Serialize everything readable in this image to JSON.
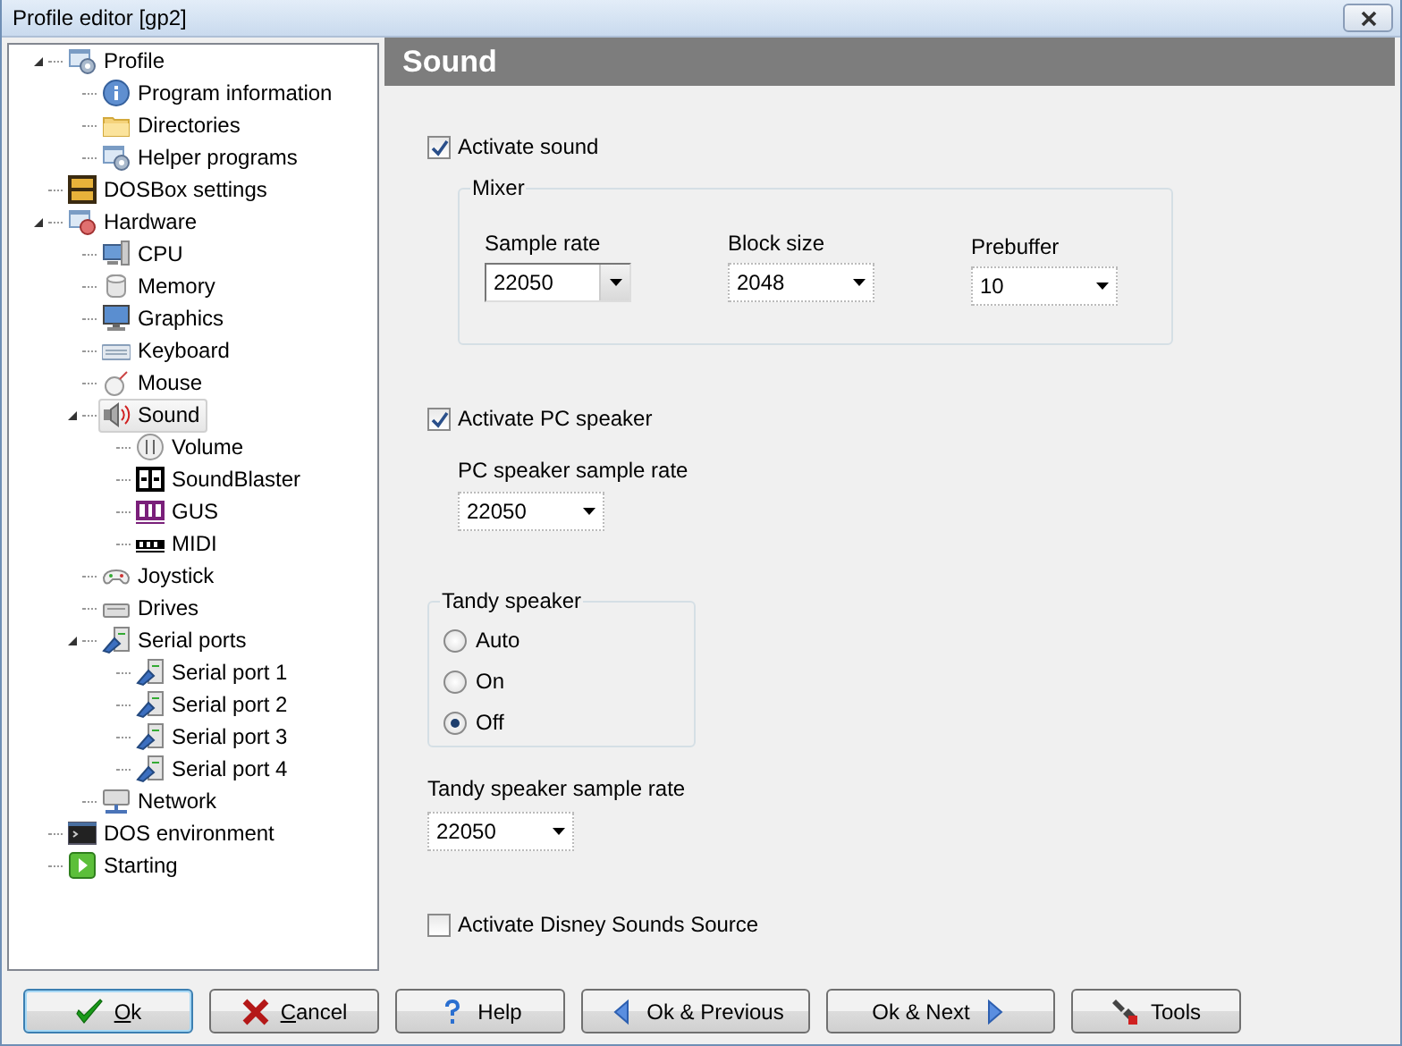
{
  "window": {
    "title": "Profile editor [gp2]"
  },
  "tree": {
    "items": [
      {
        "label": "Profile",
        "kind": "profile",
        "selected": false,
        "expanded": true,
        "children": [
          {
            "label": "Program information",
            "kind": "info",
            "selected": false
          },
          {
            "label": "Directories",
            "kind": "folder",
            "selected": false
          },
          {
            "label": "Helper programs",
            "kind": "profile",
            "selected": false
          }
        ]
      },
      {
        "label": "DOSBox settings",
        "kind": "dosbox",
        "selected": false
      },
      {
        "label": "Hardware",
        "kind": "hardware",
        "selected": false,
        "expanded": true,
        "children": [
          {
            "label": "CPU",
            "kind": "cpu",
            "selected": false
          },
          {
            "label": "Memory",
            "kind": "memory",
            "selected": false
          },
          {
            "label": "Graphics",
            "kind": "monitor",
            "selected": false
          },
          {
            "label": "Keyboard",
            "kind": "keyboard",
            "selected": false
          },
          {
            "label": "Mouse",
            "kind": "mouse",
            "selected": false
          },
          {
            "label": "Sound",
            "kind": "sound",
            "selected": true,
            "expanded": true,
            "children": [
              {
                "label": "Volume",
                "kind": "volume",
                "selected": false
              },
              {
                "label": "SoundBlaster",
                "kind": "sb",
                "selected": false
              },
              {
                "label": "GUS",
                "kind": "gus",
                "selected": false
              },
              {
                "label": "MIDI",
                "kind": "midi",
                "selected": false
              }
            ]
          },
          {
            "label": "Joystick",
            "kind": "joystick",
            "selected": false
          },
          {
            "label": "Drives",
            "kind": "drive",
            "selected": false
          },
          {
            "label": "Serial ports",
            "kind": "serial",
            "selected": false,
            "expanded": true,
            "children": [
              {
                "label": "Serial port 1",
                "kind": "serial",
                "selected": false
              },
              {
                "label": "Serial port 2",
                "kind": "serial",
                "selected": false
              },
              {
                "label": "Serial port 3",
                "kind": "serial",
                "selected": false
              },
              {
                "label": "Serial port 4",
                "kind": "serial",
                "selected": false
              }
            ]
          },
          {
            "label": "Network",
            "kind": "network",
            "selected": false
          }
        ]
      },
      {
        "label": "DOS environment",
        "kind": "console",
        "selected": false
      },
      {
        "label": "Starting",
        "kind": "start",
        "selected": false
      }
    ]
  },
  "panel": {
    "title": "Sound",
    "activate_sound": {
      "label": "Activate sound",
      "checked": true
    },
    "mixer": {
      "title": "Mixer",
      "fields": [
        {
          "label": "Sample rate",
          "value": "22050",
          "focused": true
        },
        {
          "label": "Block size",
          "value": "2048",
          "focused": false
        },
        {
          "label": "Prebuffer",
          "value": "10",
          "focused": false
        }
      ]
    },
    "pc_speaker": {
      "label": "Activate PC speaker",
      "checked": true
    },
    "pc_speaker_rate": {
      "label": "PC speaker sample rate",
      "value": "22050",
      "focused": false
    },
    "tandy": {
      "title": "Tandy speaker",
      "options": [
        {
          "label": "Auto",
          "selected": false
        },
        {
          "label": "On",
          "selected": false
        },
        {
          "label": "Off",
          "selected": true
        }
      ]
    },
    "tandy_rate": {
      "label": "Tandy speaker sample rate",
      "value": "22050",
      "focused": false
    },
    "disney": {
      "label": "Activate Disney Sounds Source",
      "checked": false
    }
  },
  "buttons": [
    {
      "label": "Ok",
      "kind": "ok",
      "accelerator": true,
      "default": true
    },
    {
      "label": "Cancel",
      "kind": "cancel",
      "accelerator": true,
      "default": false
    },
    {
      "label": "Help",
      "kind": "help",
      "accelerator": false,
      "default": false
    },
    {
      "label": "Ok & Previous",
      "kind": "previous",
      "accelerator": false,
      "default": false
    },
    {
      "label": "Ok & Next",
      "kind": "next",
      "accelerator": false,
      "default": false
    },
    {
      "label": "Tools",
      "kind": "tools",
      "accelerator": false,
      "default": false
    }
  ]
}
